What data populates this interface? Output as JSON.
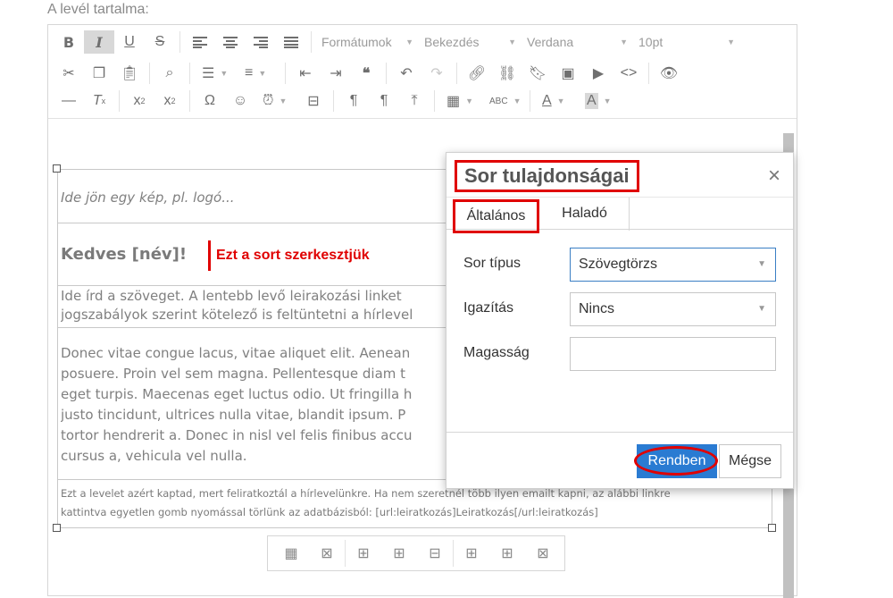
{
  "field_label": "A levél tartalma:",
  "toolbar": {
    "format_select": "Formátumok",
    "block_select": "Bekezdés",
    "font_select": "Verdana",
    "size_select": "10pt"
  },
  "content": {
    "logo_placeholder": "Ide jön egy kép, pl. logó...",
    "greeting": "Kedves [név]!",
    "annotation": "Ezt a sort szerkesztjük",
    "intro_lines": [
      "Ide írd a szöveget. A lentebb levő leirakozási linket",
      "jogszabályok szerint kötelező is feltüntetni a hírlevel"
    ],
    "lorem_lines": [
      "Donec vitae congue lacus, vitae aliquet elit. Aenean",
      "posuere. Proin vel sem magna. Pellentesque diam t",
      "eget turpis. Maecenas eget luctus odio. Ut fringilla h",
      "justo tincidunt, ultrices nulla vitae, blandit ipsum. P",
      "tortor hendrerit a. Donec in nisl vel felis finibus accu",
      "cursus a, vehicula vel nulla."
    ],
    "footer_lines": [
      "Ezt a levelet azért kaptad, mert feliratkoztál a hírlevelünkre. Ha nem szeretnél több ilyen emailt kapni, az alábbi linkre",
      "kattintva egyetlen gomb nyomással törlünk az adatbázisból: [url:leiratkozás]Leiratkozás[/url:leiratkozás]"
    ]
  },
  "dialog": {
    "title": "Sor tulajdonságai",
    "close_label": "×",
    "tabs": [
      "Általános",
      "Haladó"
    ],
    "fields": {
      "row_type": {
        "label": "Sor típus",
        "value": "Szövegtörzs"
      },
      "alignment": {
        "label": "Igazítás",
        "value": "Nincs"
      },
      "height": {
        "label": "Magasság",
        "value": ""
      }
    },
    "ok_label": "Rendben",
    "cancel_label": "Mégse"
  },
  "colors": {
    "annotation_red": "#e00000",
    "ok_blue": "#2a7bd2",
    "focus_border": "#3a7ec4"
  }
}
